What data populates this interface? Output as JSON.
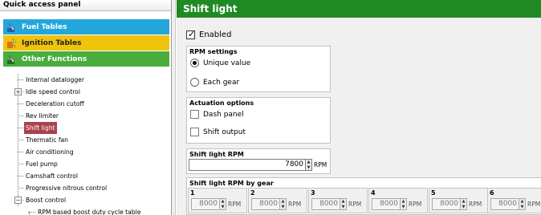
{
  "left_panel": {
    "header": "Quick access panel",
    "categories": [
      {
        "label": "Fuel Tables",
        "icon": "fuel-table-icon",
        "color": "#23a6dc"
      },
      {
        "label": "Ignition Tables",
        "icon": "ignition-table-icon",
        "color": "#f1c40c"
      },
      {
        "label": "Other Functions",
        "icon": "other-functions-icon",
        "color": "#4aac3d"
      }
    ],
    "tree": [
      {
        "label": "Internal datalogger"
      },
      {
        "label": "Idle speed control",
        "expander": "+"
      },
      {
        "label": "Deceleration cutoff"
      },
      {
        "label": "Rev limiter"
      },
      {
        "label": "Shift light",
        "selected": true
      },
      {
        "label": "Thermatic fan"
      },
      {
        "label": "Air conditioning"
      },
      {
        "label": "Fuel pump"
      },
      {
        "label": "Camshaft control"
      },
      {
        "label": "Progressive nitrous control"
      },
      {
        "label": "Boost control",
        "expander": "−"
      },
      {
        "label": "RPM based boost duty cycle table"
      }
    ],
    "selected_color": "#a9424a"
  },
  "main": {
    "title": "Shift light",
    "title_color": "#1f8a24",
    "enabled_label": "Enabled",
    "rpm_settings": {
      "title": "RPM settings",
      "option_unique": "Unique value",
      "option_each_gear": "Each gear"
    },
    "actuation": {
      "title": "Actuation options",
      "dash_panel": "Dash panel",
      "shift_output": "Shift output"
    },
    "shift_rpm": {
      "title": "Shift light RPM",
      "value": "7800",
      "unit": "RPM"
    },
    "by_gear": {
      "title": "Shift light RPM by gear",
      "unit": "RPM",
      "gears": [
        {
          "num": "1",
          "value": "8000"
        },
        {
          "num": "2",
          "value": "8000"
        },
        {
          "num": "3",
          "value": "8000"
        },
        {
          "num": "4",
          "value": "8000"
        },
        {
          "num": "5",
          "value": "8000"
        },
        {
          "num": "6",
          "value": "8000"
        }
      ]
    }
  }
}
